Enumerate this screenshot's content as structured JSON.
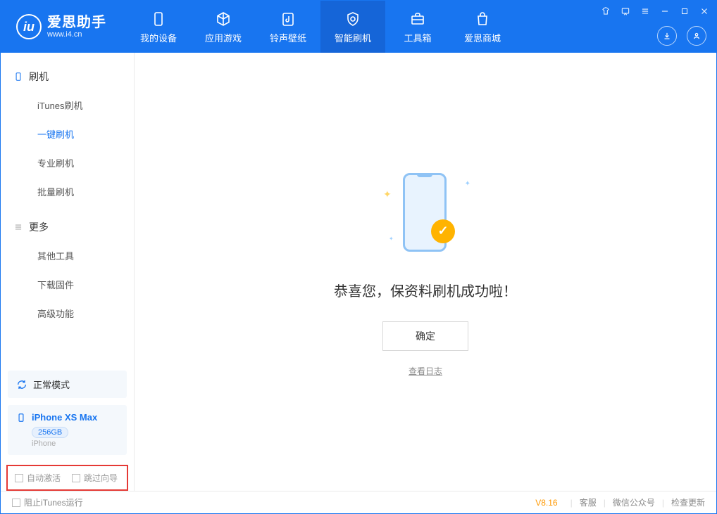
{
  "app": {
    "name": "爱思助手",
    "url": "www.i4.cn"
  },
  "tabs": {
    "device": "我的设备",
    "apps": "应用游戏",
    "ring": "铃声壁纸",
    "flash": "智能刷机",
    "tools": "工具箱",
    "store": "爱思商城"
  },
  "sidebar": {
    "group_flash": "刷机",
    "items_flash": {
      "itunes": "iTunes刷机",
      "oneclick": "一键刷机",
      "pro": "专业刷机",
      "batch": "批量刷机"
    },
    "group_more": "更多",
    "items_more": {
      "other": "其他工具",
      "firmware": "下载固件",
      "advanced": "高级功能"
    }
  },
  "device": {
    "mode": "正常模式",
    "name": "iPhone XS Max",
    "capacity": "256GB",
    "type": "iPhone"
  },
  "options": {
    "auto_activate": "自动激活",
    "skip_guide": "跳过向导"
  },
  "main": {
    "success": "恭喜您，保资料刷机成功啦！",
    "ok": "确定",
    "view_log": "查看日志"
  },
  "footer": {
    "stop_itunes": "阻止iTunes运行",
    "version": "V8.16",
    "support": "客服",
    "wechat": "微信公众号",
    "update": "检查更新"
  }
}
